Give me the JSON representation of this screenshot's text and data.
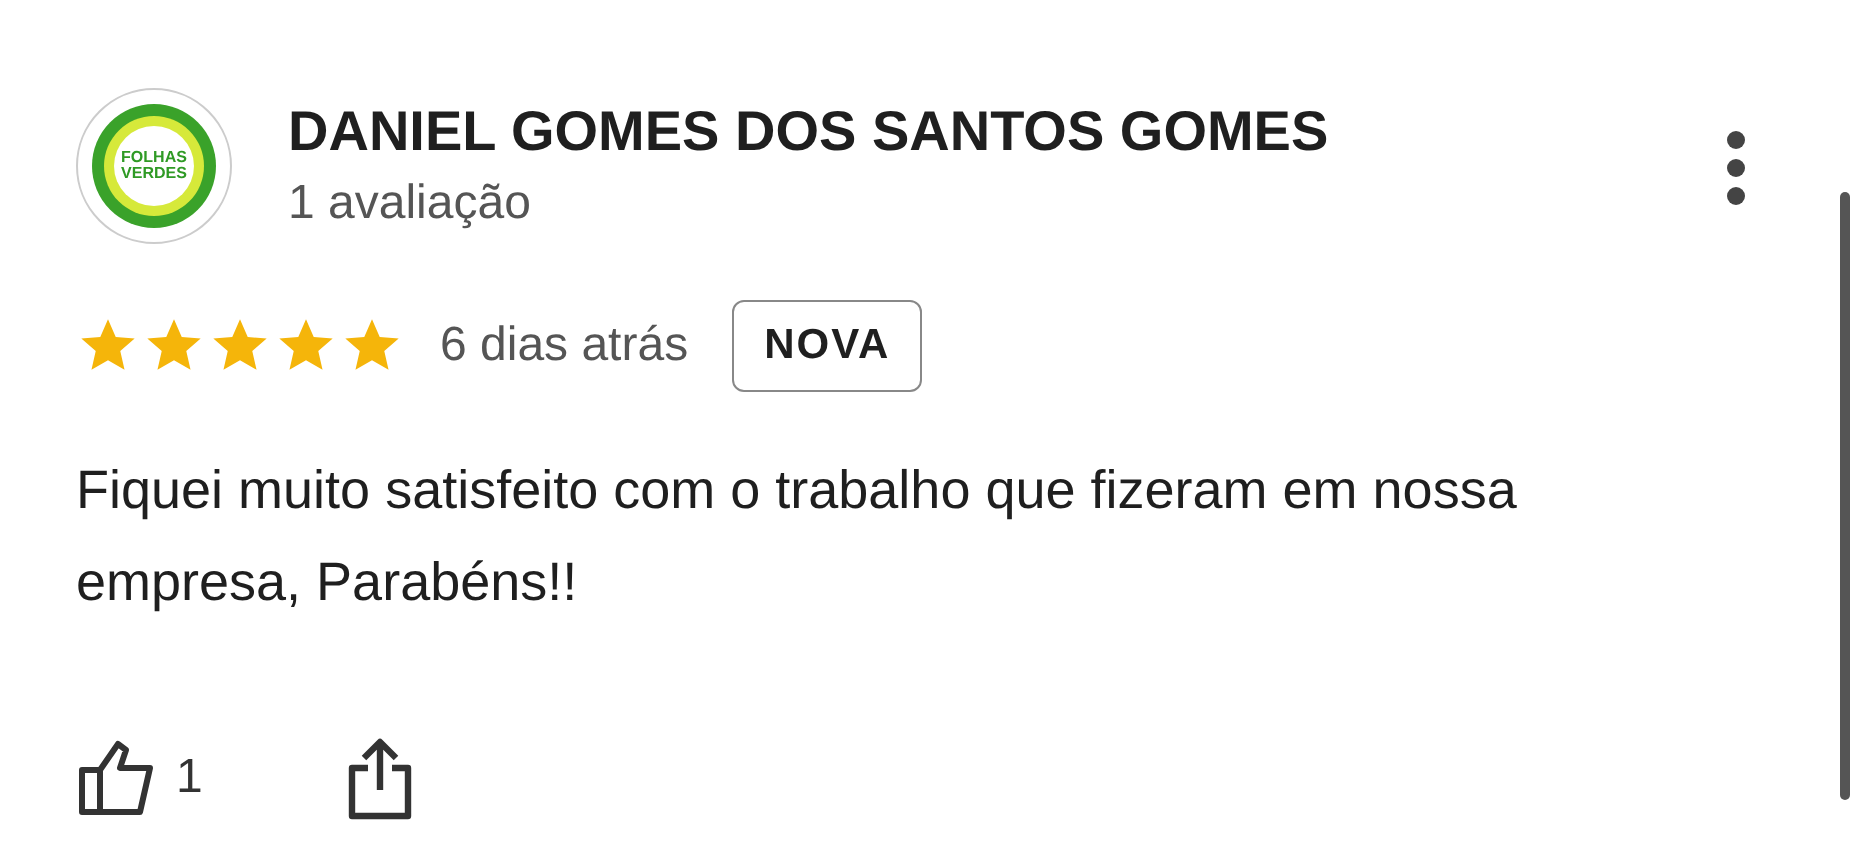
{
  "reviewer": {
    "avatar": {
      "line1": "FOLHAS",
      "line2": "VERDES"
    },
    "name": "DANIEL GOMES DOS SANTOS GOMES",
    "review_count": "1 avaliação"
  },
  "review": {
    "stars": 5,
    "time": "6 dias atrás",
    "badge": "NOVA",
    "text": "Fiquei muito satisfeito com o trabalho que fizeram em nossa empresa, Parabéns!!"
  },
  "actions": {
    "likes": "1"
  }
}
